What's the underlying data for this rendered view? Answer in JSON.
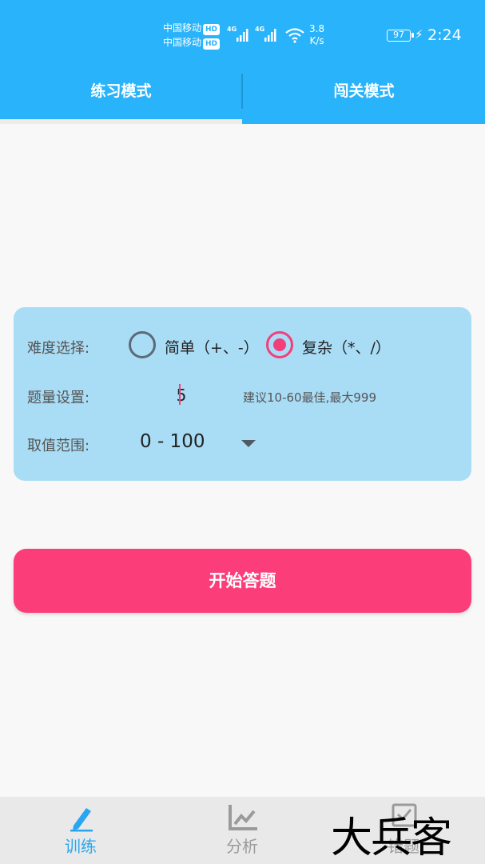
{
  "status_bar": {
    "carrier_1": "中国移动",
    "carrier_2": "中国移动",
    "hd_badge": "HD",
    "network_1": "4G",
    "network_2": "4G",
    "speed_value": "3.8",
    "speed_unit": "K/s",
    "battery": "97",
    "time": "2:24"
  },
  "tabs": [
    {
      "label": "练习模式",
      "active": true
    },
    {
      "label": "闯关模式",
      "active": false
    }
  ],
  "settings": {
    "difficulty_label": "难度选择:",
    "options": [
      {
        "label": "简单（+、-）",
        "checked": false
      },
      {
        "label": "复杂（*、/）",
        "checked": true
      }
    ],
    "quantity_label": "题量设置:",
    "quantity_value": "5",
    "quantity_hint": "建议10-60最佳,最大999",
    "range_label": "取值范围:",
    "range_value": "0 - 100"
  },
  "start_button": "开始答题",
  "bottom_nav": [
    {
      "label": "训练",
      "icon": "pencil-icon",
      "active": true
    },
    {
      "label": "分析",
      "icon": "chart-icon",
      "active": false
    },
    {
      "label": "错题",
      "icon": "checkbox-icon",
      "active": false
    }
  ],
  "watermark": "大兵客",
  "colors": {
    "primary": "#29b3fa",
    "accent": "#fb3e7a",
    "panel": "#a9dcf5"
  }
}
